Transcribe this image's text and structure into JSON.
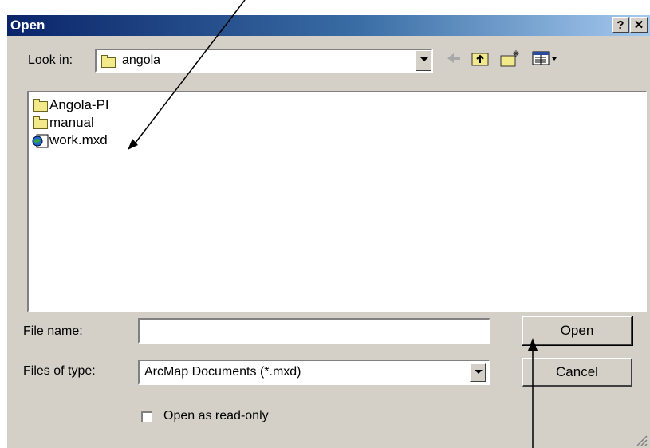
{
  "window": {
    "title": "Open"
  },
  "titlebar": {
    "help_label": "?",
    "close_label": "✕"
  },
  "lookin": {
    "label": "Look in:",
    "value": "angola"
  },
  "toolbar": {
    "icons": [
      "back-icon",
      "up-folder-icon",
      "new-folder-icon",
      "view-menu-icon"
    ]
  },
  "files": [
    {
      "name": "Angola-PI",
      "icon": "folder-icon"
    },
    {
      "name": "manual",
      "icon": "folder-icon"
    },
    {
      "name": "work.mxd",
      "icon": "arcmap-document-icon"
    }
  ],
  "filename": {
    "label": "File name:",
    "value": ""
  },
  "filetype": {
    "label": "Files of type:",
    "value": "ArcMap Documents (*.mxd)"
  },
  "buttons": {
    "open": "Open",
    "cancel": "Cancel"
  },
  "readonly": {
    "label": "Open as read-only",
    "checked": false
  },
  "colors": {
    "title_start": "#0a246a",
    "title_end": "#a6caf0",
    "dialog_bg": "#d4d0c8"
  }
}
